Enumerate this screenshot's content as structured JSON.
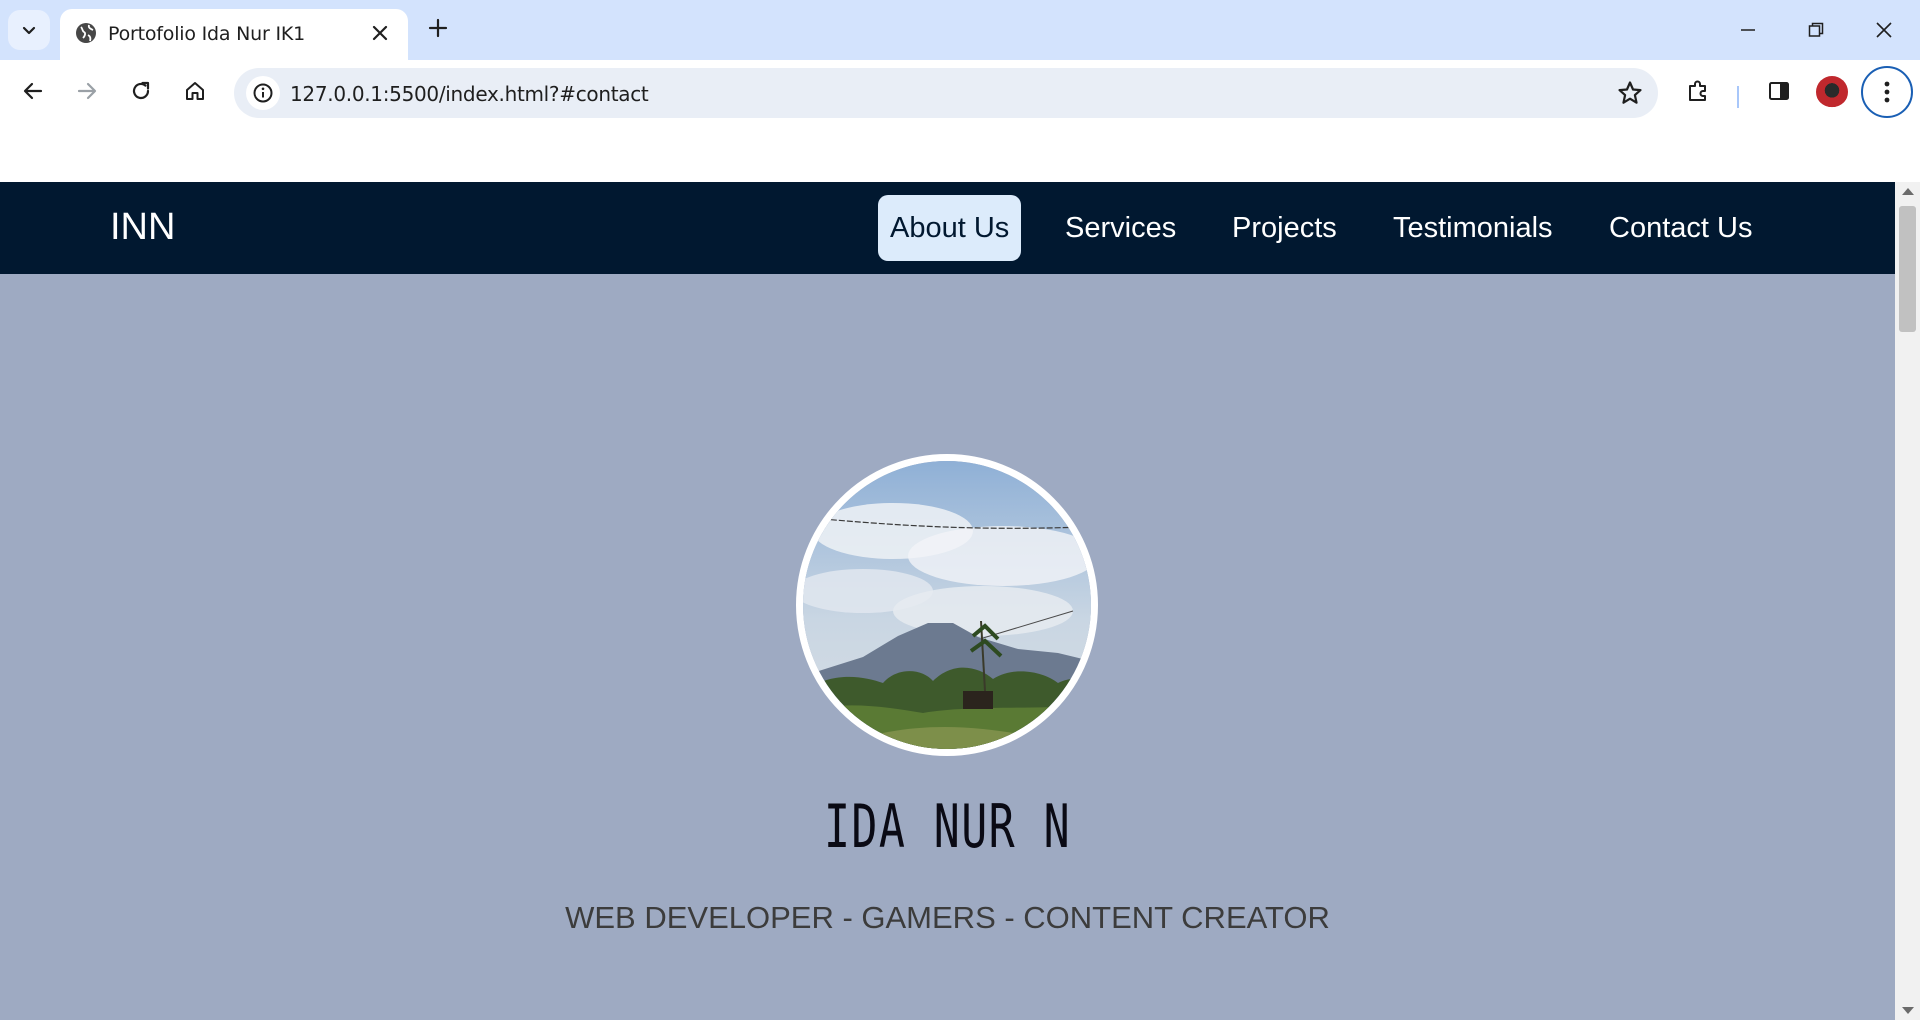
{
  "browser": {
    "tab_title": "Portofolio Ida Nur IK1",
    "url": "127.0.0.1:5500/index.html?#contact"
  },
  "site": {
    "brand": "INN",
    "nav": [
      {
        "label": "About Us",
        "active": true
      },
      {
        "label": "Services"
      },
      {
        "label": "Projects"
      },
      {
        "label": "Testimonials"
      },
      {
        "label": "Contact Us"
      }
    ],
    "hero": {
      "name": "IDA NUR N",
      "tagline": "WEB DEVELOPER - GAMERS - CONTENT CREATOR"
    }
  },
  "colors": {
    "navbar_bg": "#011830",
    "page_bg": "#9eaac2",
    "active_nav_bg": "#dcebfb",
    "tabstrip_bg": "#d3e3fd"
  },
  "icons": [
    "tab-search-icon",
    "globe-icon",
    "close-icon",
    "plus-icon",
    "minimize-icon",
    "restore-icon",
    "back-icon",
    "forward-icon",
    "reload-icon",
    "home-icon",
    "info-icon",
    "star-icon",
    "extensions-icon",
    "side-panel-icon",
    "kebab-menu-icon"
  ]
}
